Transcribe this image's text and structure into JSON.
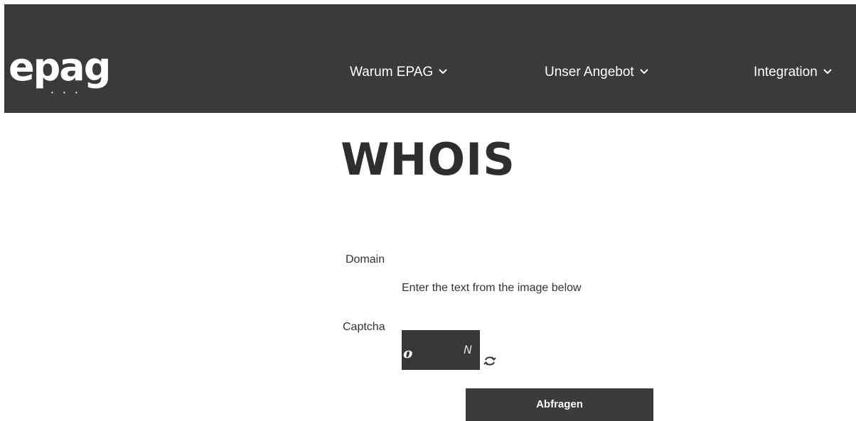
{
  "header": {
    "logo_text": "epag",
    "logo_dots": "• • •",
    "nav": [
      {
        "label": "Warum EPAG",
        "icon": "chevron-down-icon"
      },
      {
        "label": "Unser Angebot",
        "icon": "chevron-down-icon"
      },
      {
        "label": "Integration",
        "icon": "chevron-down-icon"
      }
    ],
    "colors": {
      "background": "#3a3a3a",
      "text": "#ffffff"
    }
  },
  "main": {
    "title": "WHOIS",
    "form": {
      "domain_label": "Domain",
      "domain_value": "",
      "captcha_hint": "Enter the text from the image below",
      "captcha_label": "Captcha",
      "captcha_image_chars": [
        "o",
        "N"
      ],
      "captcha_value": "",
      "refresh_icon": "refresh-icon",
      "submit_label": "Abfragen"
    }
  }
}
